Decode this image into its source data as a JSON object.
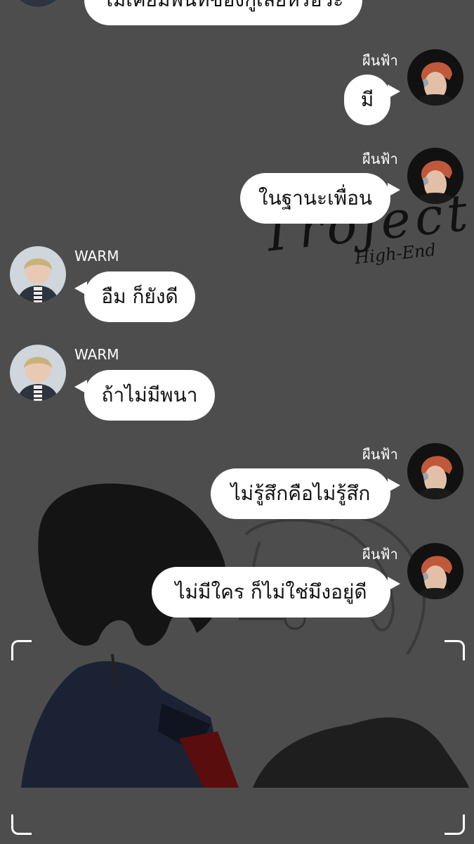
{
  "watermark": {
    "main": "Troject",
    "sub": "High-End"
  },
  "messages": [
    {
      "side": "left",
      "sender": "",
      "text": "ไม่เคยมีพื้นที่ของกูเลยหรือวะ"
    },
    {
      "side": "right",
      "sender": "ผืนฟ้า",
      "text": "มี"
    },
    {
      "side": "right",
      "sender": "ผืนฟ้า",
      "text": "ในฐานะเพื่อน"
    },
    {
      "side": "left",
      "sender": "WARM",
      "text": "อืม ก็ยังดี"
    },
    {
      "side": "left",
      "sender": "WARM",
      "text": "ถ้าไม่มีพนา"
    },
    {
      "side": "right",
      "sender": "ผืนฟ้า",
      "text": "ไม่รู้สึกคือไม่รู้สึก"
    },
    {
      "side": "right",
      "sender": "ผืนฟ้า",
      "text": "ไม่มีใคร ก็ไม่ใช่มึงอยู่ดี"
    }
  ]
}
